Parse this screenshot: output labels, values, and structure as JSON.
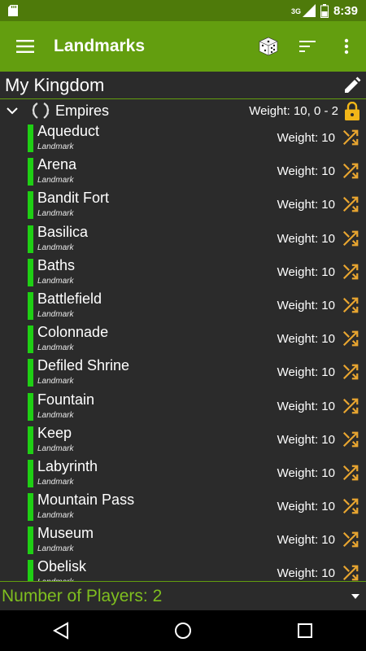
{
  "status_bar": {
    "network": "3G",
    "time": "8:39",
    "icons": [
      "sd-card-icon",
      "signal-icon",
      "battery-icon"
    ]
  },
  "app_bar": {
    "title": "Landmarks",
    "actions": [
      "menu-icon",
      "dice-icon",
      "sort-icon",
      "more-icon"
    ]
  },
  "kingdom": {
    "name": "My Kingdom"
  },
  "set": {
    "name": "Empires",
    "weight": "Weight: 10, 0 - 2"
  },
  "cards": [
    {
      "name": "Aqueduct",
      "type": "Landmark",
      "weight": "Weight: 10"
    },
    {
      "name": "Arena",
      "type": "Landmark",
      "weight": "Weight: 10"
    },
    {
      "name": "Bandit Fort",
      "type": "Landmark",
      "weight": "Weight: 10"
    },
    {
      "name": "Basilica",
      "type": "Landmark",
      "weight": "Weight: 10"
    },
    {
      "name": "Baths",
      "type": "Landmark",
      "weight": "Weight: 10"
    },
    {
      "name": "Battlefield",
      "type": "Landmark",
      "weight": "Weight: 10"
    },
    {
      "name": "Colonnade",
      "type": "Landmark",
      "weight": "Weight: 10"
    },
    {
      "name": "Defiled Shrine",
      "type": "Landmark",
      "weight": "Weight: 10"
    },
    {
      "name": "Fountain",
      "type": "Landmark",
      "weight": "Weight: 10"
    },
    {
      "name": "Keep",
      "type": "Landmark",
      "weight": "Weight: 10"
    },
    {
      "name": "Labyrinth",
      "type": "Landmark",
      "weight": "Weight: 10"
    },
    {
      "name": "Mountain Pass",
      "type": "Landmark",
      "weight": "Weight: 10"
    },
    {
      "name": "Museum",
      "type": "Landmark",
      "weight": "Weight: 10"
    },
    {
      "name": "Obelisk",
      "type": "Landmark",
      "weight": "Weight: 10"
    }
  ],
  "footer": {
    "players": "Number of Players: 2"
  },
  "colors": {
    "status_bar": "#4e7a0a",
    "app_bar": "#639e0f",
    "background": "#2b2b2b",
    "card_bar": "#1fcf14",
    "shuffle": "#e8a530",
    "lock": "#f2b618",
    "footer_text": "#7fbf1f"
  }
}
